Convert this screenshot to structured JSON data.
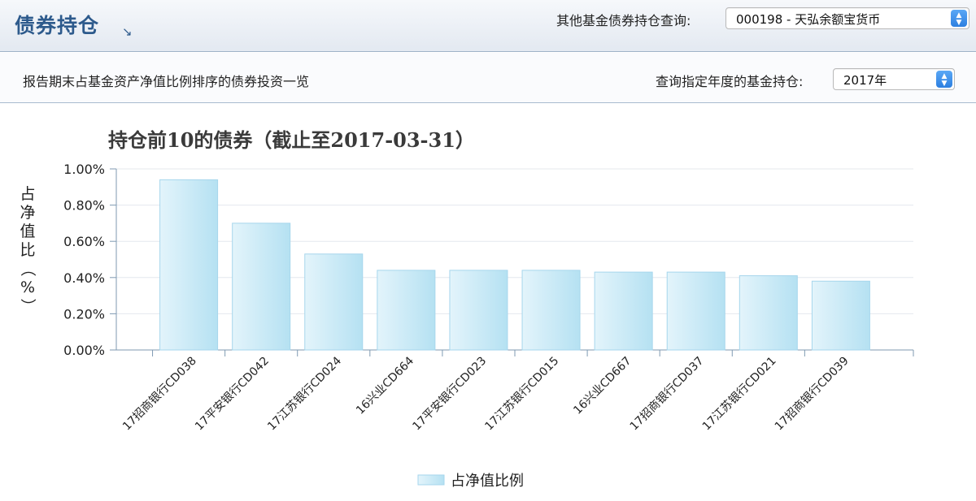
{
  "header": {
    "title": "债券持仓",
    "expand_glyph": "↘",
    "fund_query_label": "其他基金债券持仓查询:",
    "fund_select_value": "000198 - 天弘余额宝货币"
  },
  "subheader": {
    "description": "报告期末占基金资产净值比例排序的债券投资一览",
    "year_query_label": "查询指定年度的基金持仓:",
    "year_select_value": "2017年"
  },
  "colors": {
    "bar_light": "#e3f4fb",
    "bar_dark": "#b5e1f2",
    "bar_stroke": "#a6d6ec",
    "axis": "#7f9ab2",
    "grid": "#e4e8ee"
  },
  "chart_data": {
    "type": "bar",
    "title": "持仓前10的债券（截止至2017-03-31）",
    "ylabel": "占净值比（%）",
    "ylim": [
      0,
      1.0
    ],
    "yticks": [
      "0.00%",
      "0.20%",
      "0.40%",
      "0.60%",
      "0.80%",
      "1.00%"
    ],
    "categories": [
      "17招商银行CD038",
      "17平安银行CD042",
      "17江苏银行CD024",
      "16兴业CD664",
      "17平安银行CD023",
      "17江苏银行CD015",
      "16兴业CD667",
      "17招商银行CD037",
      "17江苏银行CD021",
      "17招商银行CD039"
    ],
    "series": [
      {
        "name": "占净值比例",
        "values": [
          0.94,
          0.7,
          0.53,
          0.44,
          0.44,
          0.44,
          0.43,
          0.43,
          0.41,
          0.38
        ]
      }
    ],
    "legend": "bottom-center",
    "grid": true
  }
}
